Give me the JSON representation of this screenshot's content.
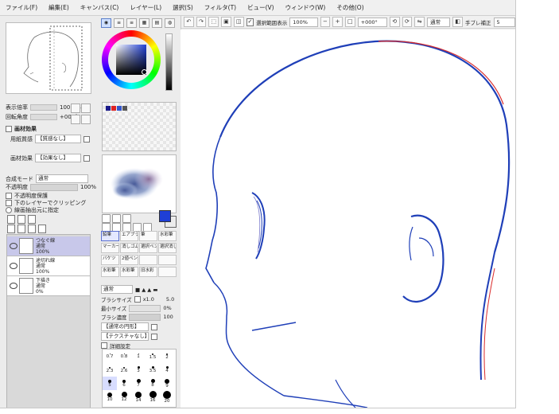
{
  "menu": [
    "ファイル(F)",
    "編集(E)",
    "キャンバス(C)",
    "レイヤー(L)",
    "選択(S)",
    "フィルタ(T)",
    "ビュー(V)",
    "ウィンドウ(W)",
    "その他(O)"
  ],
  "toolbar": {
    "selection_label": "選択範囲表示",
    "zoom": "100%",
    "rotation": "+000°",
    "mode": "通常",
    "stabilizer_label": "手ブレ補正",
    "stabilizer_value": "5"
  },
  "navigator": {
    "zoom_label": "表示倍率",
    "zoom_value": "100.0%",
    "angle_label": "回転角度",
    "angle_value": "+000°"
  },
  "paper": {
    "section": "画材効果",
    "texture_label": "用紙質感",
    "texture_value": "【質感なし】",
    "effect_label": "画材効果",
    "effect_value": "【効果なし】"
  },
  "layer_props": {
    "blend_label": "合成モード",
    "blend_value": "通常",
    "opacity_label": "不透明度",
    "opacity_value": "100%",
    "opts": [
      "不透明度保護",
      "下のレイヤーでクリッピング",
      "線画抽出元に指定"
    ]
  },
  "layers": [
    {
      "name": "つなぐ線",
      "mode": "通常",
      "opacity": "100%"
    },
    {
      "name": "途切れ線",
      "mode": "通常",
      "opacity": "100%"
    },
    {
      "name": "下描き",
      "mode": "通常",
      "opacity": "0%"
    }
  ],
  "color": {
    "fg": "#1f3fd6",
    "bg": "#ffffff",
    "swatches": [
      "#1a1a8a",
      "#d22",
      "#3355cc",
      "#555",
      "#888"
    ]
  },
  "brushes": {
    "cells": [
      "鉛筆",
      "エアブラシ",
      "筆",
      "水彩筆",
      "マーカー",
      "消しゴム",
      "選択ペン",
      "選択消し",
      "バケツ",
      "2値ペン",
      "",
      "",
      "水彩筆",
      "水彩筆",
      "旧水彩",
      ""
    ],
    "mode": "通常",
    "size_label": "ブラシサイズ",
    "size_mult": "x1.0",
    "size_value": "5.0",
    "min_label": "最小サイズ",
    "min_value": "0%",
    "density_label": "ブラシ濃度",
    "density_value": "100",
    "shape": "【通常の円形】",
    "texture": "【テクスチャなし】",
    "detail_label": "詳細設定",
    "sizes": [
      "0.7",
      "0.8",
      "1",
      "1.5",
      "2",
      "2.3",
      "2.6",
      "3",
      "3.5",
      "4",
      "5",
      "6",
      "7",
      "8",
      "9",
      "10",
      "12",
      "14",
      "16",
      "20"
    ]
  },
  "strokes": {
    "primary": "#1f3fb8",
    "secondary": "#d92b2b"
  }
}
